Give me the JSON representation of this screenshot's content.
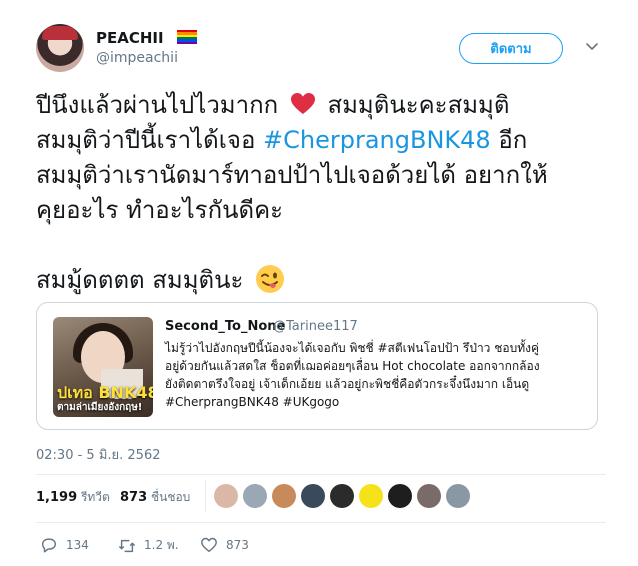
{
  "author": {
    "name": "PEACHII",
    "handle": "@impeachii",
    "flag_colors": [
      "#e40303",
      "#ff8c00",
      "#ffed00",
      "#008026",
      "#004dff",
      "#750787"
    ]
  },
  "follow_button": {
    "label": "ติดตาม"
  },
  "tweet": {
    "line1_before": "ปีนึงแล้วผ่านไปไวมากก",
    "line1_after": "สมมุตินะคะสมมุติ",
    "line2_before": "สมมุติว่าปีนี้เราได้เจอ",
    "hashtag": "#CherprangBNK48",
    "line2_after": "อีก",
    "line3": "สมมุติว่าเรานัดมาร์ทาอปป้าไปเจอด้วยได้ อยากให้",
    "line4": "คุยอะไร ทำอะไรกันดีคะ",
    "line5": "สมมู้ดตตต สมมุตินะ",
    "heart_emoji": "heart-emoji",
    "wink_emoji": "winking-tongue-emoji"
  },
  "quote": {
    "name": "Second_To_None",
    "handle": "@Tarinee117",
    "image_caption_1": "ปเทอ BNK48",
    "image_caption_2": "ตามล่าเมียงอังกฤษ!",
    "lines": [
      "ไม่รู้ว่าไปอังกฤษปีนี้น้องจะได้เจอกับ พิชชี่ #สตีเฟนโอปป้า รึป่าว ชอบทั้งคู่",
      "อยู่ด้วยกันแล้วสดใส ช็อตที่เฌอค่อยๆเลื่อน Hot chocolate ออกจากกล้อง",
      "ยังติดตาตรึงใจอยู่ เจ้าเด็กเอ้ยย แล้วอยู่กะพิชชี่คือตัวกระจึ๋งนึงมาก เอ็นดู",
      "#CherprangBNK48 #UKgogo"
    ]
  },
  "timestamp": "02:30 - 5 มิ.ย. 2562",
  "stats": {
    "retweets_count": "1,199",
    "retweets_label": "รีทวีต",
    "likes_count": "873",
    "likes_label": "ชื่นชอบ"
  },
  "likers": [
    "#d9b8a8",
    "#9aa7b4",
    "#c98a5a",
    "#3a4a5a",
    "#2b2b2b",
    "#f5e21a",
    "#1e1e1e",
    "#7a6a6a",
    "#8a97a4"
  ],
  "actions": {
    "reply_count": "134",
    "retweet_count": "1.2 พ.",
    "like_count": "873"
  },
  "colors": {
    "accent": "#1da1f2",
    "hashtag": "#1b95e0",
    "muted": "#657786"
  }
}
